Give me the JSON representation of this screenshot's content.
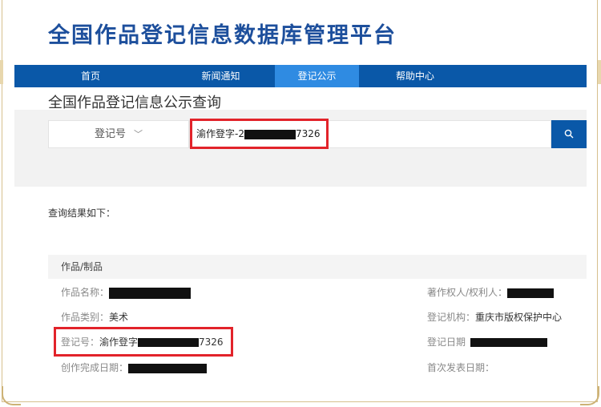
{
  "header": {
    "title": "全国作品登记信息数据库管理平台"
  },
  "nav": {
    "items": [
      {
        "label": "首页"
      },
      {
        "label": "新闻通知"
      },
      {
        "label": "登记公示"
      },
      {
        "label": "帮助中心"
      }
    ],
    "active_index": 2
  },
  "search": {
    "heading": "全国作品登记信息公示查询",
    "type_label": "登记号",
    "query_prefix": "渝作登字-2",
    "query_suffix": "7326"
  },
  "results": {
    "label": "查询结果如下：",
    "section_title": "作品/制品",
    "fields": {
      "work_name_label": "作品名称：",
      "copyright_owner_label": "著作权人/权利人：",
      "category_label": "作品类别：",
      "category_value": "美术",
      "registry_org_label": "登记机构：",
      "registry_org_value": "重庆市版权保护中心",
      "reg_no_label": "登记号：",
      "reg_no_prefix": "渝作登字",
      "reg_no_suffix": "7326",
      "reg_date_label": "登记日期",
      "completion_date_label": "创作完成日期：",
      "first_pub_date_label": "首次发表日期："
    }
  },
  "colors": {
    "brand_blue": "#0a58a8",
    "active_tab": "#2f8be2",
    "title_blue": "#1d4f9c",
    "highlight_red": "#e2232a"
  }
}
